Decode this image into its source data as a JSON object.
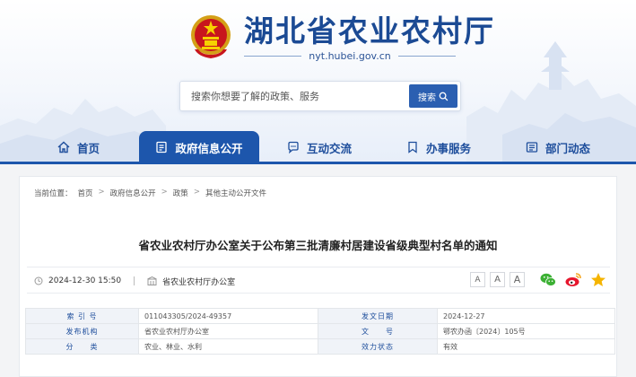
{
  "site": {
    "title": "湖北省农业农村厅",
    "domain": "nyt.hubei.gov.cn"
  },
  "search": {
    "placeholder": "搜索你想要了解的政策、服务",
    "button_label": "搜索"
  },
  "nav": {
    "items": [
      {
        "label": "首页",
        "icon": "home-icon"
      },
      {
        "label": "政府信息公开",
        "icon": "document-icon",
        "active": true
      },
      {
        "label": "互动交流",
        "icon": "chat-icon"
      },
      {
        "label": "办事服务",
        "icon": "bookmark-icon"
      },
      {
        "label": "部门动态",
        "icon": "news-icon"
      }
    ]
  },
  "breadcrumb": {
    "prefix": "当前位置：",
    "items": [
      "首页",
      "政府信息公开",
      "政策",
      "其他主动公开文件"
    ],
    "separator": ">"
  },
  "article": {
    "title": "省农业农村厅办公室关于公布第三批清廉村居建设省级典型村名单的通知",
    "datetime": "2024-12-30 15:50",
    "source": "省农业农村厅办公室",
    "font_sizes": [
      "A",
      "A",
      "A"
    ]
  },
  "info_table": [
    {
      "label1": "索 引 号",
      "value1": "011043305/2024-49357",
      "label2": "发文日期",
      "value2": "2024-12-27"
    },
    {
      "label1": "发布机构",
      "value1": "省农业农村厅办公室",
      "label2": "文　　号",
      "value2": "鄂农办函〔2024〕105号"
    },
    {
      "label1": "分　　类",
      "value1": "农业、林业、水利",
      "label2": "效力状态",
      "value2": "有效"
    }
  ],
  "colors": {
    "brand_blue": "#1d56ac",
    "title_blue": "#1b4a94"
  }
}
